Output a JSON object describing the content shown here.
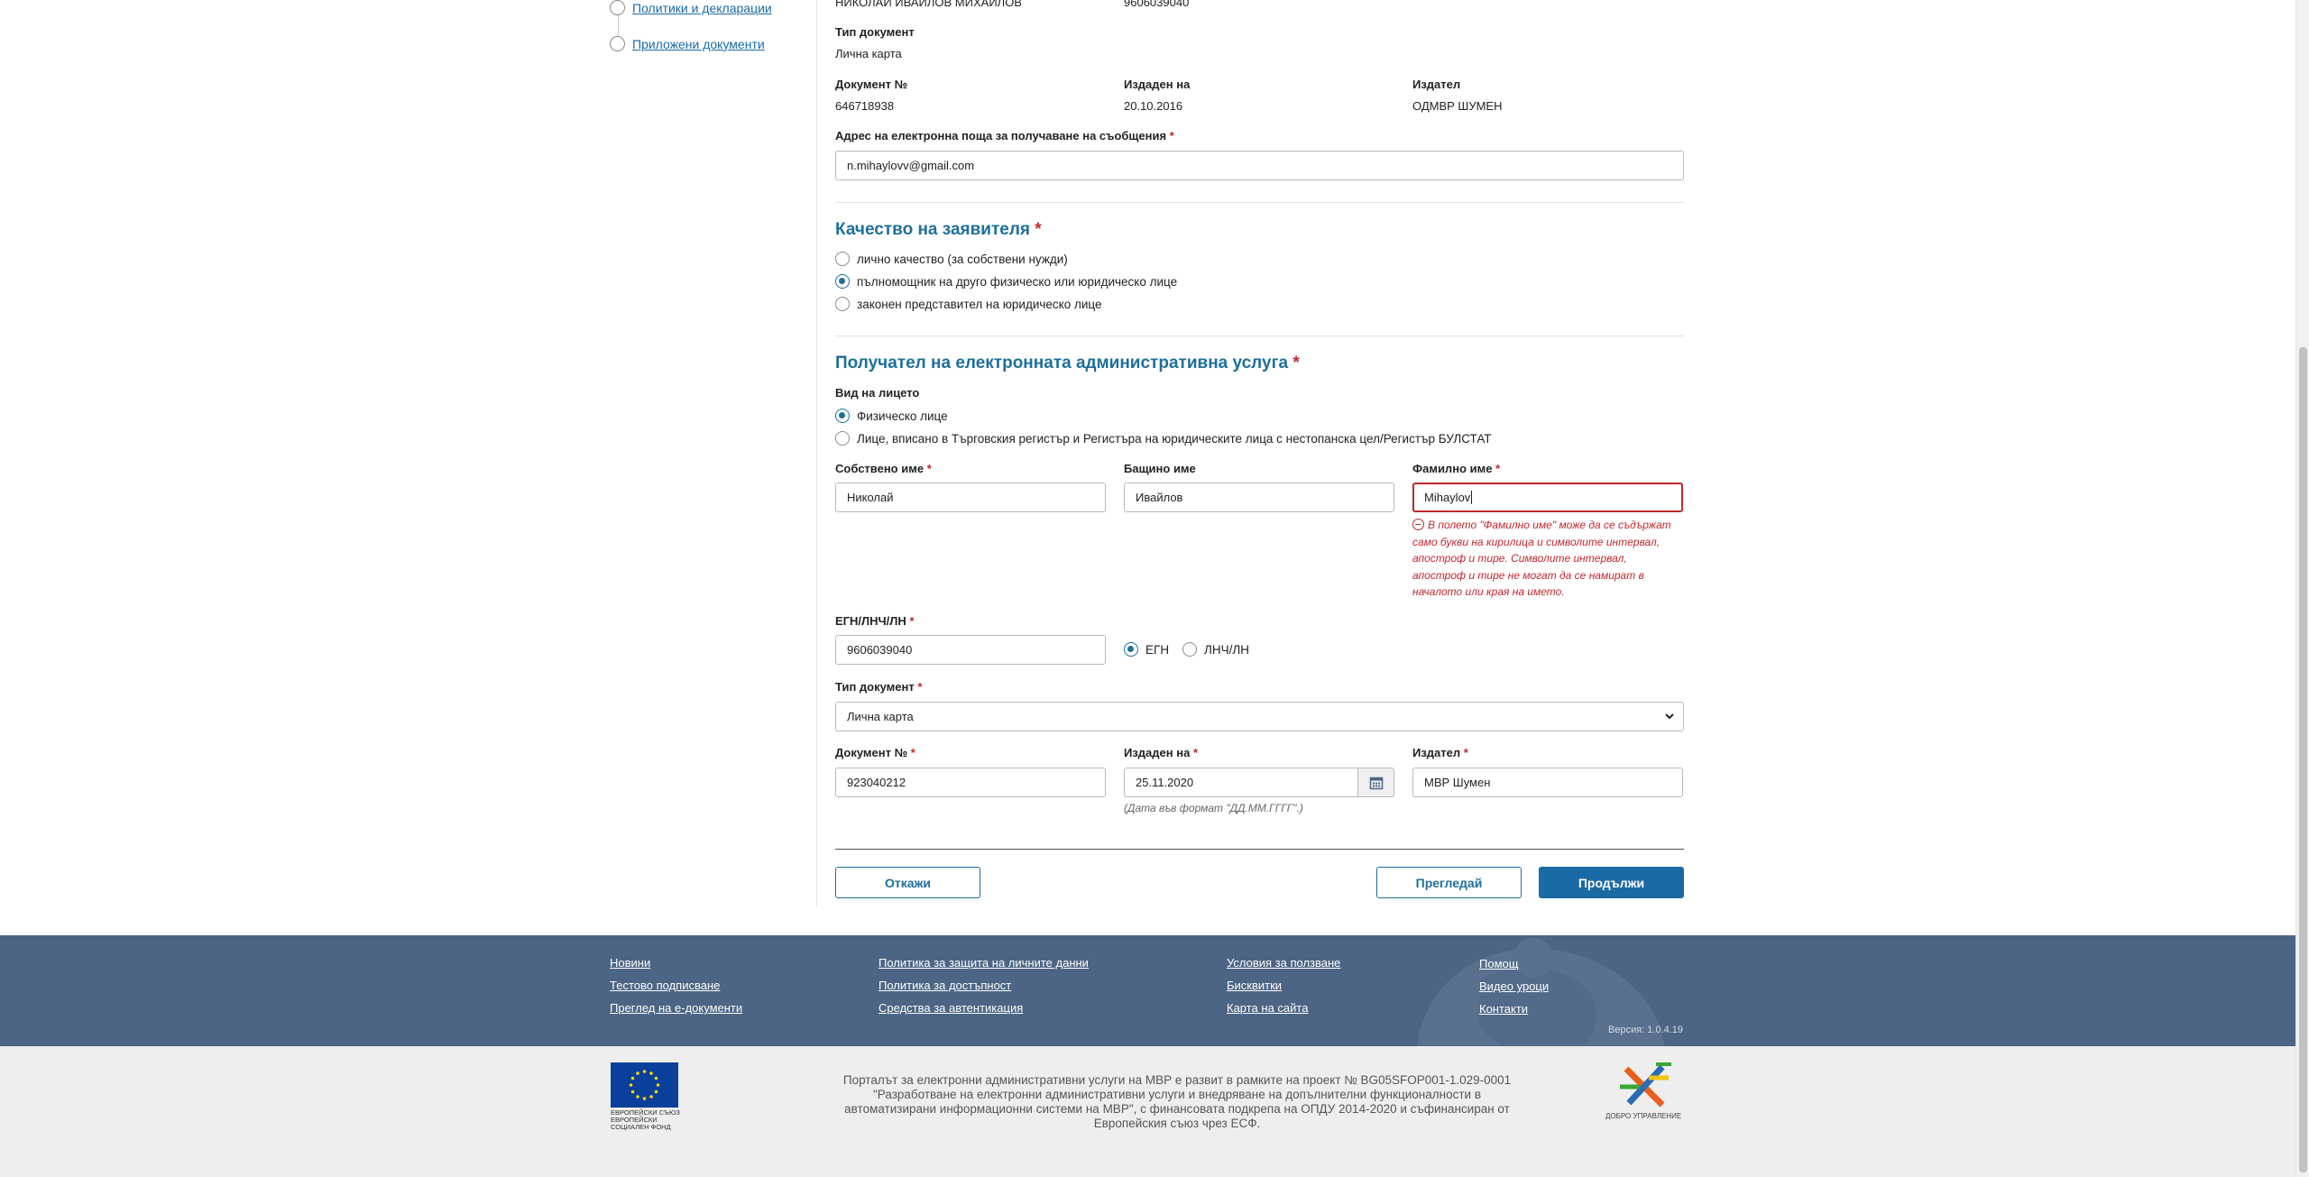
{
  "sidebar": {
    "items": [
      {
        "label": "Политики и декларации"
      },
      {
        "label": "Приложени документи"
      }
    ]
  },
  "applicant": {
    "name_top": "НИКОЛАЙ ИВАЙЛОВ МИХАЙЛОВ",
    "id_top": "9606039040",
    "doc_type_label": "Тип документ",
    "doc_type_value": "Лична карта",
    "doc_no_label": "Документ №",
    "doc_no_value": "646718938",
    "issued_label": "Издаден на",
    "issued_value": "20.10.2016",
    "issuer_label": "Издател",
    "issuer_value": "ОДМВР ШУМЕН",
    "email_label": "Адрес на електронна поща за получаване на съобщения",
    "email_value": "n.mihaylovv@gmail.com"
  },
  "quality": {
    "heading": "Качество на заявителя",
    "options": [
      "лично качество (за собствени нужди)",
      "пълномощник на друго физическо или юридическо лице",
      "законен представител на юридическо лице"
    ],
    "selected_index": 1
  },
  "recipient": {
    "heading": "Получател на електронната административна услуга",
    "person_type_label": "Вид на лицето",
    "person_types": [
      "Физическо лице",
      "Лице, вписано в Търговския регистър и Регистъра на юридическите лица с нестопанска цел/Регистър БУЛСТАТ"
    ],
    "person_type_selected": 0,
    "first_name_label": "Собствено име",
    "first_name_value": "Николай",
    "middle_name_label": "Бащино име",
    "middle_name_value": "Ивайлов",
    "last_name_label": "Фамилно име",
    "last_name_value": "Mihaylov",
    "last_name_error": "В полето \"Фамилно име\" може да се съдържат само букви на кирилица и символите интервал, апостроф и тире. Символите интервал, апостроф и тире не могат да се намират в началото или края на името.",
    "egn_label": "ЕГН/ЛНЧ/ЛН",
    "egn_value": "9606039040",
    "egn_type_options": [
      "ЕГН",
      "ЛНЧ/ЛН"
    ],
    "egn_type_selected": 0,
    "doc_type_label": "Тип документ",
    "doc_type_value": "Лична карта",
    "doc_no_label": "Документ №",
    "doc_no_value": "923040212",
    "issued_label": "Издаден на",
    "issued_value": "25.11.2020",
    "issued_hint": "(Дата във формат \"ДД.ММ.ГГГГ\".)",
    "issuer_label": "Издател",
    "issuer_value": "МВР Шумен"
  },
  "actions": {
    "cancel": "Откажи",
    "review": "Прегледай",
    "continue": "Продължи"
  },
  "footer": {
    "col1": [
      "Новини",
      "Тестово подписване",
      "Преглед на е-документи"
    ],
    "col2": [
      "Политика за защита на личните данни",
      "Политика за достъпност",
      "Средства за автентикация"
    ],
    "col3": [
      "Условия за ползване",
      "Бисквитки",
      "Карта на сайта"
    ],
    "col4": [
      "Помощ",
      "Видео уроци",
      "Контакти"
    ],
    "version": "Версия: 1.0.4.19",
    "eu_caption": "ЕВРОПЕЙСКИ СЪЮЗ ЕВРОПЕЙСКИ СОЦИАЛЕН ФОНД",
    "project_text": "Порталът за електронни административни услуги на МВР е развит в рамките на проект № BG05SFOP001-1.029-0001 \"Разработване на електронни административни услуги и внедряване на допълнителни функционалности в автоматизирани информационни системи на МВР\", с финансовата подкрепа на ОПДУ 2014-2020 и съфинансиран от Европейския съюз чрез ЕСФ.",
    "gg_caption": "ДОБРО УПРАВЛЕНИЕ"
  },
  "colors": {
    "accent": "#1e6f9b",
    "error": "#c0282d",
    "footer_bg": "#4d6585"
  }
}
